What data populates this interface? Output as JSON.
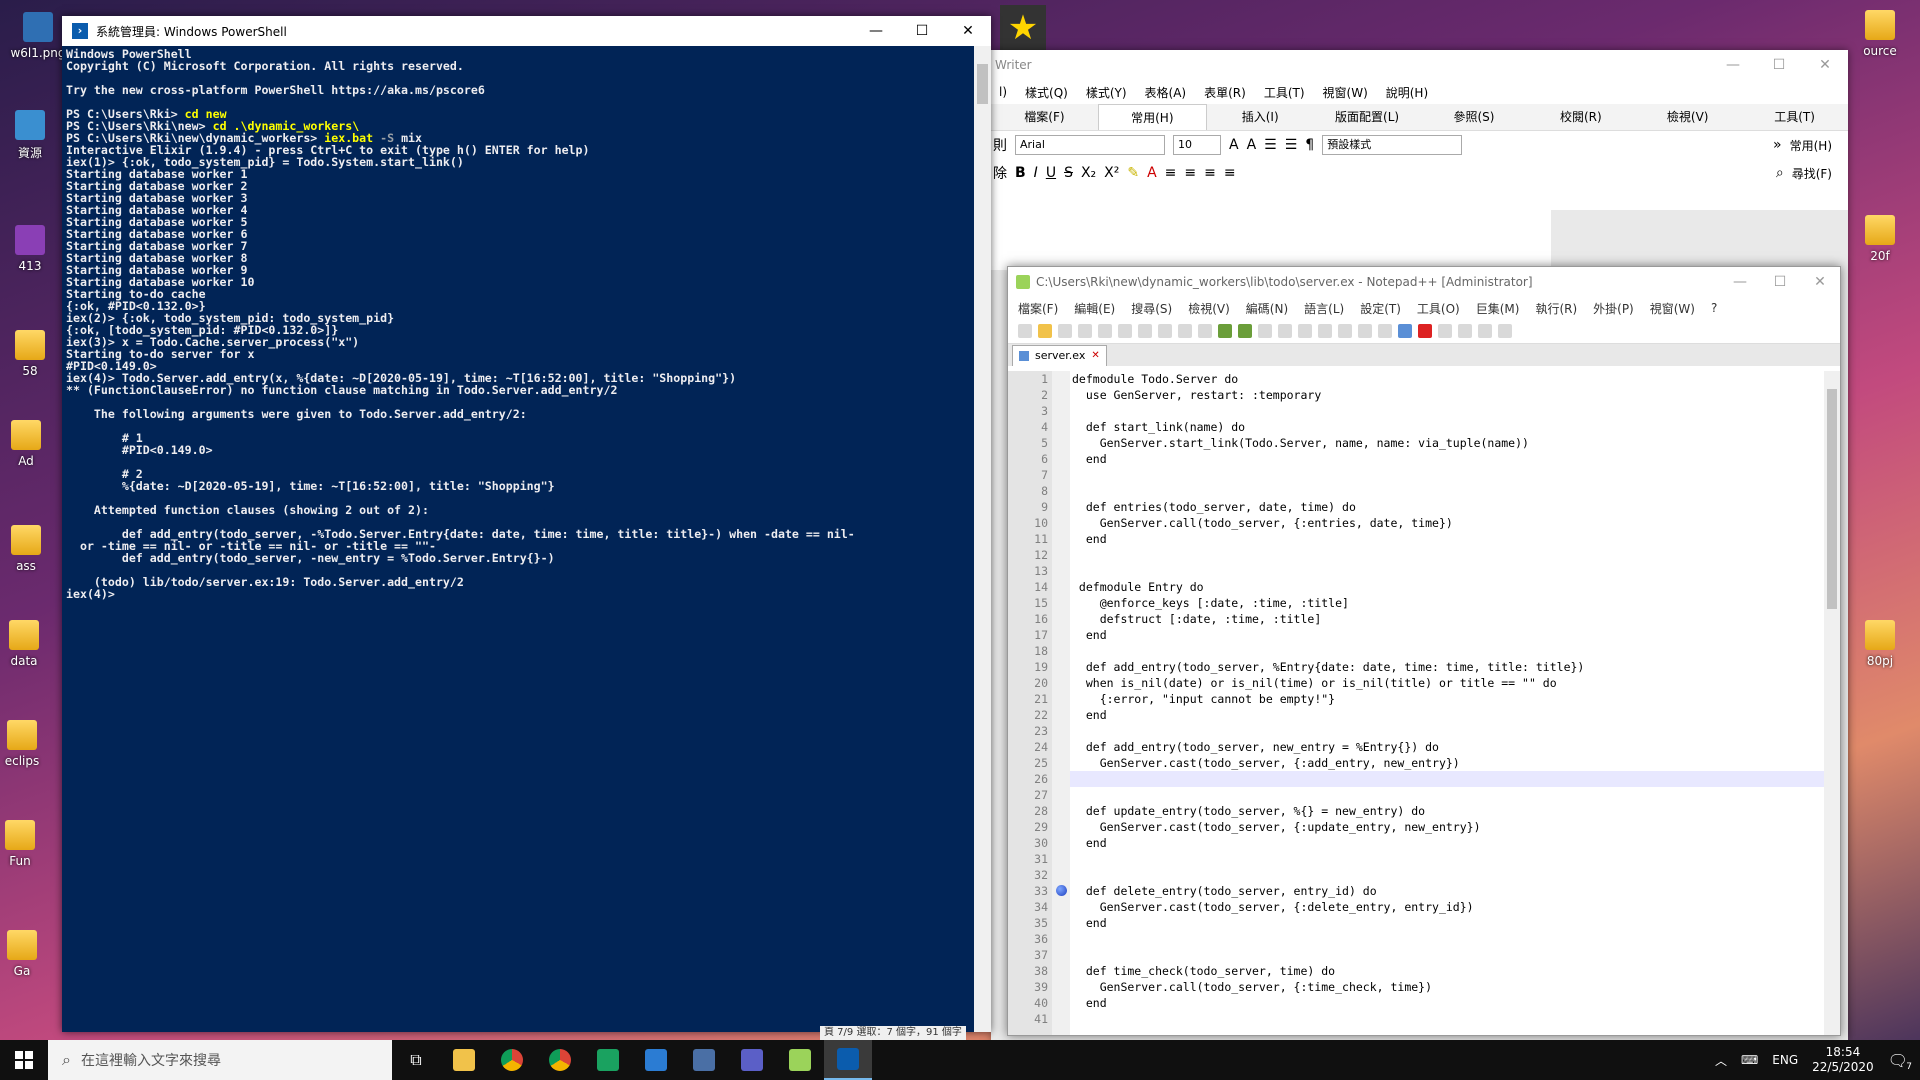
{
  "desktop": {
    "icons": [
      {
        "label": "w6l1.png"
      },
      {
        "label": "資源"
      },
      {
        "label": "413"
      },
      {
        "label": "ass"
      },
      {
        "label": "58"
      },
      {
        "label": "Ad"
      },
      {
        "label": "data"
      },
      {
        "label": "eclips"
      },
      {
        "label": "Fun"
      },
      {
        "label": "Ga"
      }
    ],
    "right_icons": [
      {
        "label": "ource"
      },
      {
        "label": "20f"
      },
      {
        "label": "80pj"
      }
    ]
  },
  "powershell": {
    "title": "系統管理員: Windows PowerShell",
    "lines": [
      {
        "t": "Windows PowerShell"
      },
      {
        "t": "Copyright (C) Microsoft Corporation. All rights reserved."
      },
      {
        "t": ""
      },
      {
        "t": "Try the new cross-platform PowerShell https://aka.ms/pscore6"
      },
      {
        "t": ""
      },
      {
        "t": "PS C:\\Users\\Rki> ",
        "y": "cd new"
      },
      {
        "t": "PS C:\\Users\\Rki\\new> ",
        "y": "cd .\\dynamic_workers\\"
      },
      {
        "t": "PS C:\\Users\\Rki\\new\\dynamic_workers> ",
        "y": "iex.bat",
        "g": " -S ",
        "r": "mix"
      },
      {
        "t": "Interactive Elixir (1.9.4) - press Ctrl+C to exit (type h() ENTER for help)"
      },
      {
        "t": "iex(1)> {:ok, todo_system_pid} = Todo.System.start_link()"
      },
      {
        "t": "Starting database worker 1"
      },
      {
        "t": "Starting database worker 2"
      },
      {
        "t": "Starting database worker 3"
      },
      {
        "t": "Starting database worker 4"
      },
      {
        "t": "Starting database worker 5"
      },
      {
        "t": "Starting database worker 6"
      },
      {
        "t": "Starting database worker 7"
      },
      {
        "t": "Starting database worker 8"
      },
      {
        "t": "Starting database worker 9"
      },
      {
        "t": "Starting database worker 10"
      },
      {
        "t": "Starting to-do cache"
      },
      {
        "t": "{:ok, #PID<0.132.0>}"
      },
      {
        "t": "iex(2)> {:ok, todo_system_pid: todo_system_pid}"
      },
      {
        "t": "{:ok, [todo_system_pid: #PID<0.132.0>]}"
      },
      {
        "t": "iex(3)> x = Todo.Cache.server_process(\"x\")"
      },
      {
        "t": "Starting to-do server for x"
      },
      {
        "t": "#PID<0.149.0>"
      },
      {
        "t": "iex(4)> Todo.Server.add_entry(x, %{date: ~D[2020-05-19], time: ~T[16:52:00], title: \"Shopping\"})"
      },
      {
        "t": "** (FunctionClauseError) no function clause matching in Todo.Server.add_entry/2"
      },
      {
        "t": ""
      },
      {
        "t": "    The following arguments were given to Todo.Server.add_entry/2:"
      },
      {
        "t": ""
      },
      {
        "t": "        # 1"
      },
      {
        "t": "        #PID<0.149.0>"
      },
      {
        "t": ""
      },
      {
        "t": "        # 2"
      },
      {
        "t": "        %{date: ~D[2020-05-19], time: ~T[16:52:00], title: \"Shopping\"}"
      },
      {
        "t": ""
      },
      {
        "t": "    Attempted function clauses (showing 2 out of 2):"
      },
      {
        "t": ""
      },
      {
        "t": "        def add_entry(todo_server, -%Todo.Server.Entry{date: date, time: time, title: title}-) when -date == nil-"
      },
      {
        "t": "  or -time == nil- or -title == nil- or -title == \"\"-"
      },
      {
        "t": "        def add_entry(todo_server, -new_entry = %Todo.Server.Entry{}-)"
      },
      {
        "t": ""
      },
      {
        "t": "    (todo) lib/todo/server.ex:19: Todo.Server.add_entry/2"
      },
      {
        "t": "iex(4)>"
      }
    ]
  },
  "writer": {
    "title": "Writer",
    "menu": [
      "l)",
      "樣式(Q)",
      "樣式(Y)",
      "表格(A)",
      "表單(R)",
      "工具(T)",
      "視窗(W)",
      "說明(H)"
    ],
    "tabs": [
      "檔案(F)",
      "常用(H)",
      "插入(I)",
      "版面配置(L)",
      "參照(S)",
      "校閱(R)",
      "檢視(V)",
      "工具(T)"
    ],
    "font": "Arial",
    "size": "10",
    "style": "預設樣式",
    "right_label": "常用(H)",
    "find_label": "尋找(F)",
    "row_label_1": "則",
    "row_label_2": "除"
  },
  "notepad": {
    "title": "C:\\Users\\Rki\\new\\dynamic_workers\\lib\\todo\\server.ex - Notepad++ [Administrator]",
    "menu": [
      "檔案(F)",
      "編輯(E)",
      "搜尋(S)",
      "檢視(V)",
      "編碼(N)",
      "語言(L)",
      "設定(T)",
      "工具(O)",
      "巨集(M)",
      "執行(R)",
      "外掛(P)",
      "視窗(W)",
      "?"
    ],
    "tab": "server.ex",
    "lines": [
      "defmodule Todo.Server do",
      "  use GenServer, restart: :temporary",
      "",
      "  def start_link(name) do",
      "    GenServer.start_link(Todo.Server, name, name: via_tuple(name))",
      "  end",
      "",
      "",
      "  def entries(todo_server, date, time) do",
      "    GenServer.call(todo_server, {:entries, date, time})",
      "  end",
      "",
      "",
      " defmodule Entry do",
      "    @enforce_keys [:date, :time, :title]",
      "    defstruct [:date, :time, :title]",
      "  end",
      "",
      "  def add_entry(todo_server, %Entry{date: date, time: time, title: title})",
      "  when is_nil(date) or is_nil(time) or is_nil(title) or title == \"\" do",
      "    {:error, \"input cannot be empty!\"}",
      "  end",
      "",
      "  def add_entry(todo_server, new_entry = %Entry{}) do",
      "    GenServer.cast(todo_server, {:add_entry, new_entry})",
      "  end",
      "",
      "  def update_entry(todo_server, %{} = new_entry) do",
      "    GenServer.cast(todo_server, {:update_entry, new_entry})",
      "  end",
      "",
      "",
      "  def delete_entry(todo_server, entry_id) do",
      "    GenServer.cast(todo_server, {:delete_entry, entry_id})",
      "  end",
      "",
      "",
      "  def time_check(todo_server, time) do",
      "    GenServer.call(todo_server, {:time_check, time})",
      "  end",
      ""
    ],
    "bookmark_line": 33,
    "current_line": 26
  },
  "statusbar_fragment": "頁 7/9    選取：7 個字，91 個字",
  "taskbar": {
    "search_placeholder": "在這裡輸入文字來搜尋",
    "lang": "ENG",
    "time": "18:54",
    "date": "22/5/2020",
    "notif_count": "7"
  },
  "colors": {
    "ps_bg": "#012456",
    "ps_text": "#eeedf0",
    "ps_highlight": "#ffff00",
    "accent": "#76b9ed"
  }
}
